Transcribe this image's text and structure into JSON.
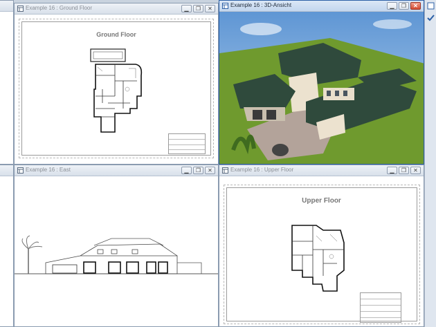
{
  "windows": {
    "ground": {
      "title": "Example 16 : Ground Floor",
      "sheet_title": "Ground Floor"
    },
    "view3d": {
      "title": "Example 16 : 3D-Ansicht"
    },
    "east": {
      "title": "Example 16 : East"
    },
    "upper": {
      "title": "Example 16 : Upper Floor",
      "sheet_title": "Upper Floor"
    }
  },
  "buttons": {
    "minimize": "▁",
    "restore": "❐",
    "close": "✕"
  },
  "colors": {
    "active_border": "#2b5fa6",
    "roof": "#2f4a3c",
    "grass": "#6f9a2e",
    "sky": "#8db8e4"
  }
}
